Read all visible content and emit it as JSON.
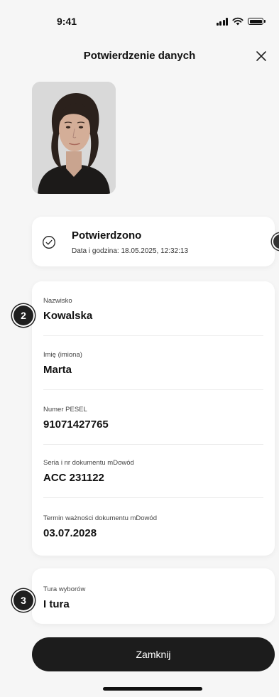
{
  "status_bar": {
    "time": "9:41"
  },
  "header": {
    "title": "Potwierdzenie danych",
    "close_icon": "close-icon"
  },
  "photo": {
    "kind": "id-portrait"
  },
  "confirmation": {
    "title": "Potwierdzono",
    "datetime": "Data i godzina: 18.05.2025, 12:32:13",
    "icon": "check-circle-icon"
  },
  "fields": [
    {
      "label": "Nazwisko",
      "value": "Kowalska"
    },
    {
      "label": "Imię (imiona)",
      "value": "Marta"
    },
    {
      "label": "Numer PESEL",
      "value": "91071427765"
    },
    {
      "label": "Seria i nr dokumentu mDowód",
      "value": "ACC 231122"
    },
    {
      "label": "Termin ważności dokumentu mDowód",
      "value": "03.07.2028"
    }
  ],
  "election_round": {
    "label": "Tura wyborów",
    "value": "I tura"
  },
  "badges": {
    "b2": "2",
    "b3": "3"
  },
  "footer": {
    "button_label": "Zamknij"
  },
  "colors": {
    "background": "#f6f6f6",
    "card": "#ffffff",
    "button": "#1c1c1c",
    "badge": "#1f1f1f"
  }
}
